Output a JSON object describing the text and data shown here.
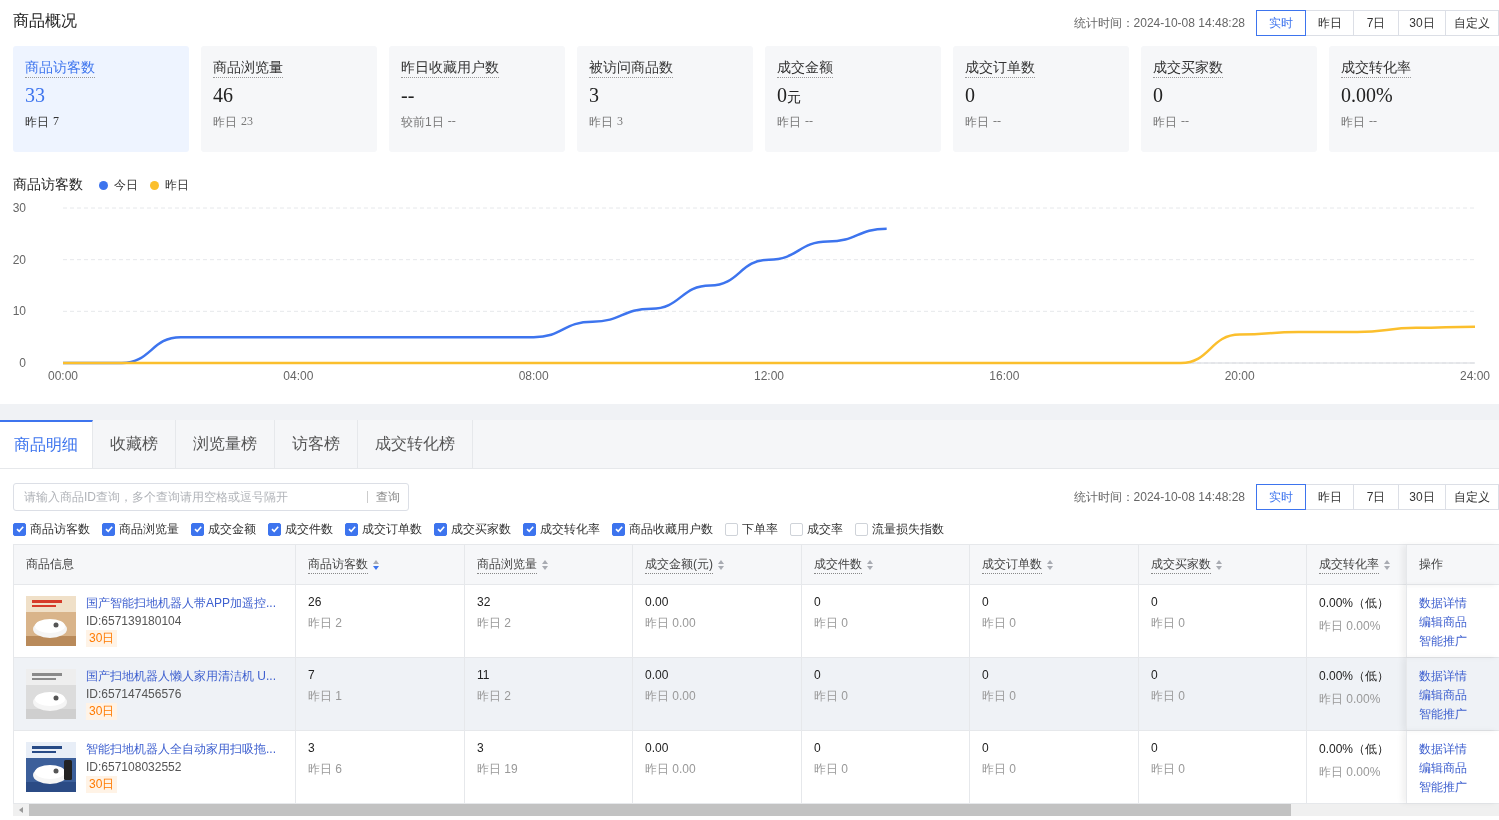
{
  "title": "商品概况",
  "stat_time": "统计时间：2024-10-08 14:48:28",
  "range_buttons": [
    {
      "label": "实时",
      "selected": true
    },
    {
      "label": "昨日",
      "selected": false
    },
    {
      "label": "7日",
      "selected": false
    },
    {
      "label": "30日",
      "selected": false
    },
    {
      "label": "自定义",
      "selected": false
    }
  ],
  "cards": [
    {
      "label": "商品访客数",
      "value": "33",
      "compare_label": "昨日",
      "compare_value": "7",
      "selected": true
    },
    {
      "label": "商品浏览量",
      "value": "46",
      "compare_label": "昨日",
      "compare_value": "23",
      "selected": false
    },
    {
      "label": "昨日收藏用户数",
      "value": "--",
      "compare_label": "较前1日",
      "compare_value": "--",
      "selected": false
    },
    {
      "label": "被访问商品数",
      "value": "3",
      "compare_label": "昨日",
      "compare_value": "3",
      "selected": false
    },
    {
      "label": "成交金额",
      "value": "0",
      "unit": "元",
      "compare_label": "昨日",
      "compare_value": "--",
      "selected": false
    },
    {
      "label": "成交订单数",
      "value": "0",
      "compare_label": "昨日",
      "compare_value": "--",
      "selected": false
    },
    {
      "label": "成交买家数",
      "value": "0",
      "compare_label": "昨日",
      "compare_value": "--",
      "selected": false
    },
    {
      "label": "成交转化率",
      "value": "0.00%",
      "compare_label": "昨日",
      "compare_value": "--",
      "selected": false
    }
  ],
  "chart": {
    "chart_data": {
      "type": "line",
      "title": "商品访客数",
      "legend": true,
      "x": [
        0,
        1,
        2,
        3,
        4,
        5,
        6,
        7,
        8,
        9,
        10,
        11,
        12,
        13,
        14,
        15,
        16,
        17,
        18,
        19,
        20,
        21,
        22,
        23,
        24
      ],
      "xlim": [
        0,
        24
      ],
      "ylim": [
        0,
        30
      ],
      "xticks": [
        {
          "value": 0,
          "label": "00:00"
        },
        {
          "value": 4,
          "label": "04:00"
        },
        {
          "value": 8,
          "label": "08:00"
        },
        {
          "value": 12,
          "label": "12:00"
        },
        {
          "value": 16,
          "label": "16:00"
        },
        {
          "value": 20,
          "label": "20:00"
        },
        {
          "value": 24,
          "label": "24:00"
        }
      ],
      "yticks": [
        0,
        10,
        20,
        30
      ],
      "series": [
        {
          "name": "今日",
          "color": "#3d74ee",
          "values": [
            0,
            0,
            5,
            5,
            5,
            5,
            5,
            5,
            5,
            8,
            10.5,
            15,
            20,
            23.5,
            26,
            null,
            null,
            null,
            null,
            null,
            null,
            null,
            null,
            null,
            null
          ]
        },
        {
          "name": "昨日",
          "color": "#fbbf2d",
          "values": [
            0,
            0,
            0,
            0,
            0,
            0,
            0,
            0,
            0,
            0,
            0,
            0,
            0,
            0,
            0,
            0,
            0,
            0,
            0,
            0,
            5.5,
            6,
            6,
            6.8,
            7
          ]
        }
      ]
    }
  },
  "tabs": [
    {
      "label": "商品明细",
      "selected": true
    },
    {
      "label": "收藏榜",
      "selected": false
    },
    {
      "label": "浏览量榜",
      "selected": false
    },
    {
      "label": "访客榜",
      "selected": false
    },
    {
      "label": "成交转化榜",
      "selected": false
    }
  ],
  "search": {
    "placeholder": "请输入商品ID查询，多个查询请用空格或逗号隔开",
    "button": "查询"
  },
  "stat_time_2": "统计时间：2024-10-08 14:48:28",
  "range_buttons_2": [
    {
      "label": "实时",
      "selected": true
    },
    {
      "label": "昨日",
      "selected": false
    },
    {
      "label": "7日",
      "selected": false
    },
    {
      "label": "30日",
      "selected": false
    },
    {
      "label": "自定义",
      "selected": false
    }
  ],
  "metric_checkboxes": [
    {
      "label": "商品访客数",
      "checked": true
    },
    {
      "label": "商品浏览量",
      "checked": true
    },
    {
      "label": "成交金额",
      "checked": true
    },
    {
      "label": "成交件数",
      "checked": true
    },
    {
      "label": "成交订单数",
      "checked": true
    },
    {
      "label": "成交买家数",
      "checked": true
    },
    {
      "label": "成交转化率",
      "checked": true
    },
    {
      "label": "商品收藏用户数",
      "checked": true
    },
    {
      "label": "下单率",
      "checked": false
    },
    {
      "label": "成交率",
      "checked": false
    },
    {
      "label": "流量损失指数",
      "checked": false
    }
  ],
  "table": {
    "columns": [
      {
        "label": "商品信息",
        "sortable": false
      },
      {
        "label": "商品访客数",
        "sortable": true,
        "sorted": true
      },
      {
        "label": "商品浏览量",
        "sortable": true,
        "sorted": false
      },
      {
        "label": "成交金额(元)",
        "sortable": true,
        "sorted": false
      },
      {
        "label": "成交件数",
        "sortable": true,
        "sorted": false
      },
      {
        "label": "成交订单数",
        "sortable": true,
        "sorted": false
      },
      {
        "label": "成交买家数",
        "sortable": true,
        "sorted": false
      },
      {
        "label": "成交转化率",
        "sortable": true,
        "sorted": false
      },
      {
        "label": "操作",
        "sortable": false
      }
    ],
    "rows": [
      {
        "highlighted": false,
        "cells": [
          {
            "kind": "product",
            "name": "国产智能扫地机器人带APP加遥控...",
            "id": "ID:657139180104",
            "badge": "30日"
          },
          {
            "kind": "metric",
            "value": "26",
            "prev": "昨日 2"
          },
          {
            "kind": "metric",
            "value": "32",
            "prev": "昨日 2"
          },
          {
            "kind": "metric",
            "value": "0.00",
            "prev": "昨日 0.00"
          },
          {
            "kind": "metric",
            "value": "0",
            "prev": "昨日 0"
          },
          {
            "kind": "metric",
            "value": "0",
            "prev": "昨日 0"
          },
          {
            "kind": "metric",
            "value": "0",
            "prev": "昨日 0"
          },
          {
            "kind": "metric",
            "value": "0.00%（低）",
            "prev": "昨日 0.00%"
          },
          {
            "kind": "actions",
            "actions": [
              "数据详情",
              "编辑商品",
              "智能推广"
            ]
          }
        ]
      },
      {
        "highlighted": true,
        "cells": [
          {
            "kind": "product",
            "name": "国产扫地机器人懒人家用清洁机 U...",
            "id": "ID:657147456576",
            "badge": "30日"
          },
          {
            "kind": "metric",
            "value": "7",
            "prev": "昨日 1"
          },
          {
            "kind": "metric",
            "value": "11",
            "prev": "昨日 2"
          },
          {
            "kind": "metric",
            "value": "0.00",
            "prev": "昨日 0.00"
          },
          {
            "kind": "metric",
            "value": "0",
            "prev": "昨日 0"
          },
          {
            "kind": "metric",
            "value": "0",
            "prev": "昨日 0"
          },
          {
            "kind": "metric",
            "value": "0",
            "prev": "昨日 0"
          },
          {
            "kind": "metric",
            "value": "0.00%（低）",
            "prev": "昨日 0.00%"
          },
          {
            "kind": "actions",
            "actions": [
              "数据详情",
              "编辑商品",
              "智能推广"
            ]
          }
        ]
      },
      {
        "highlighted": false,
        "cells": [
          {
            "kind": "product",
            "name": "智能扫地机器人全自动家用扫吸拖...",
            "id": "ID:657108032552",
            "badge": "30日"
          },
          {
            "kind": "metric",
            "value": "3",
            "prev": "昨日 6"
          },
          {
            "kind": "metric",
            "value": "3",
            "prev": "昨日 19"
          },
          {
            "kind": "metric",
            "value": "0.00",
            "prev": "昨日 0.00"
          },
          {
            "kind": "metric",
            "value": "0",
            "prev": "昨日 0"
          },
          {
            "kind": "metric",
            "value": "0",
            "prev": "昨日 0"
          },
          {
            "kind": "metric",
            "value": "0",
            "prev": "昨日 0"
          },
          {
            "kind": "metric",
            "value": "0.00%（低）",
            "prev": "昨日 0.00%"
          },
          {
            "kind": "actions",
            "actions": [
              "数据详情",
              "编辑商品",
              "智能推广"
            ]
          }
        ]
      }
    ]
  }
}
